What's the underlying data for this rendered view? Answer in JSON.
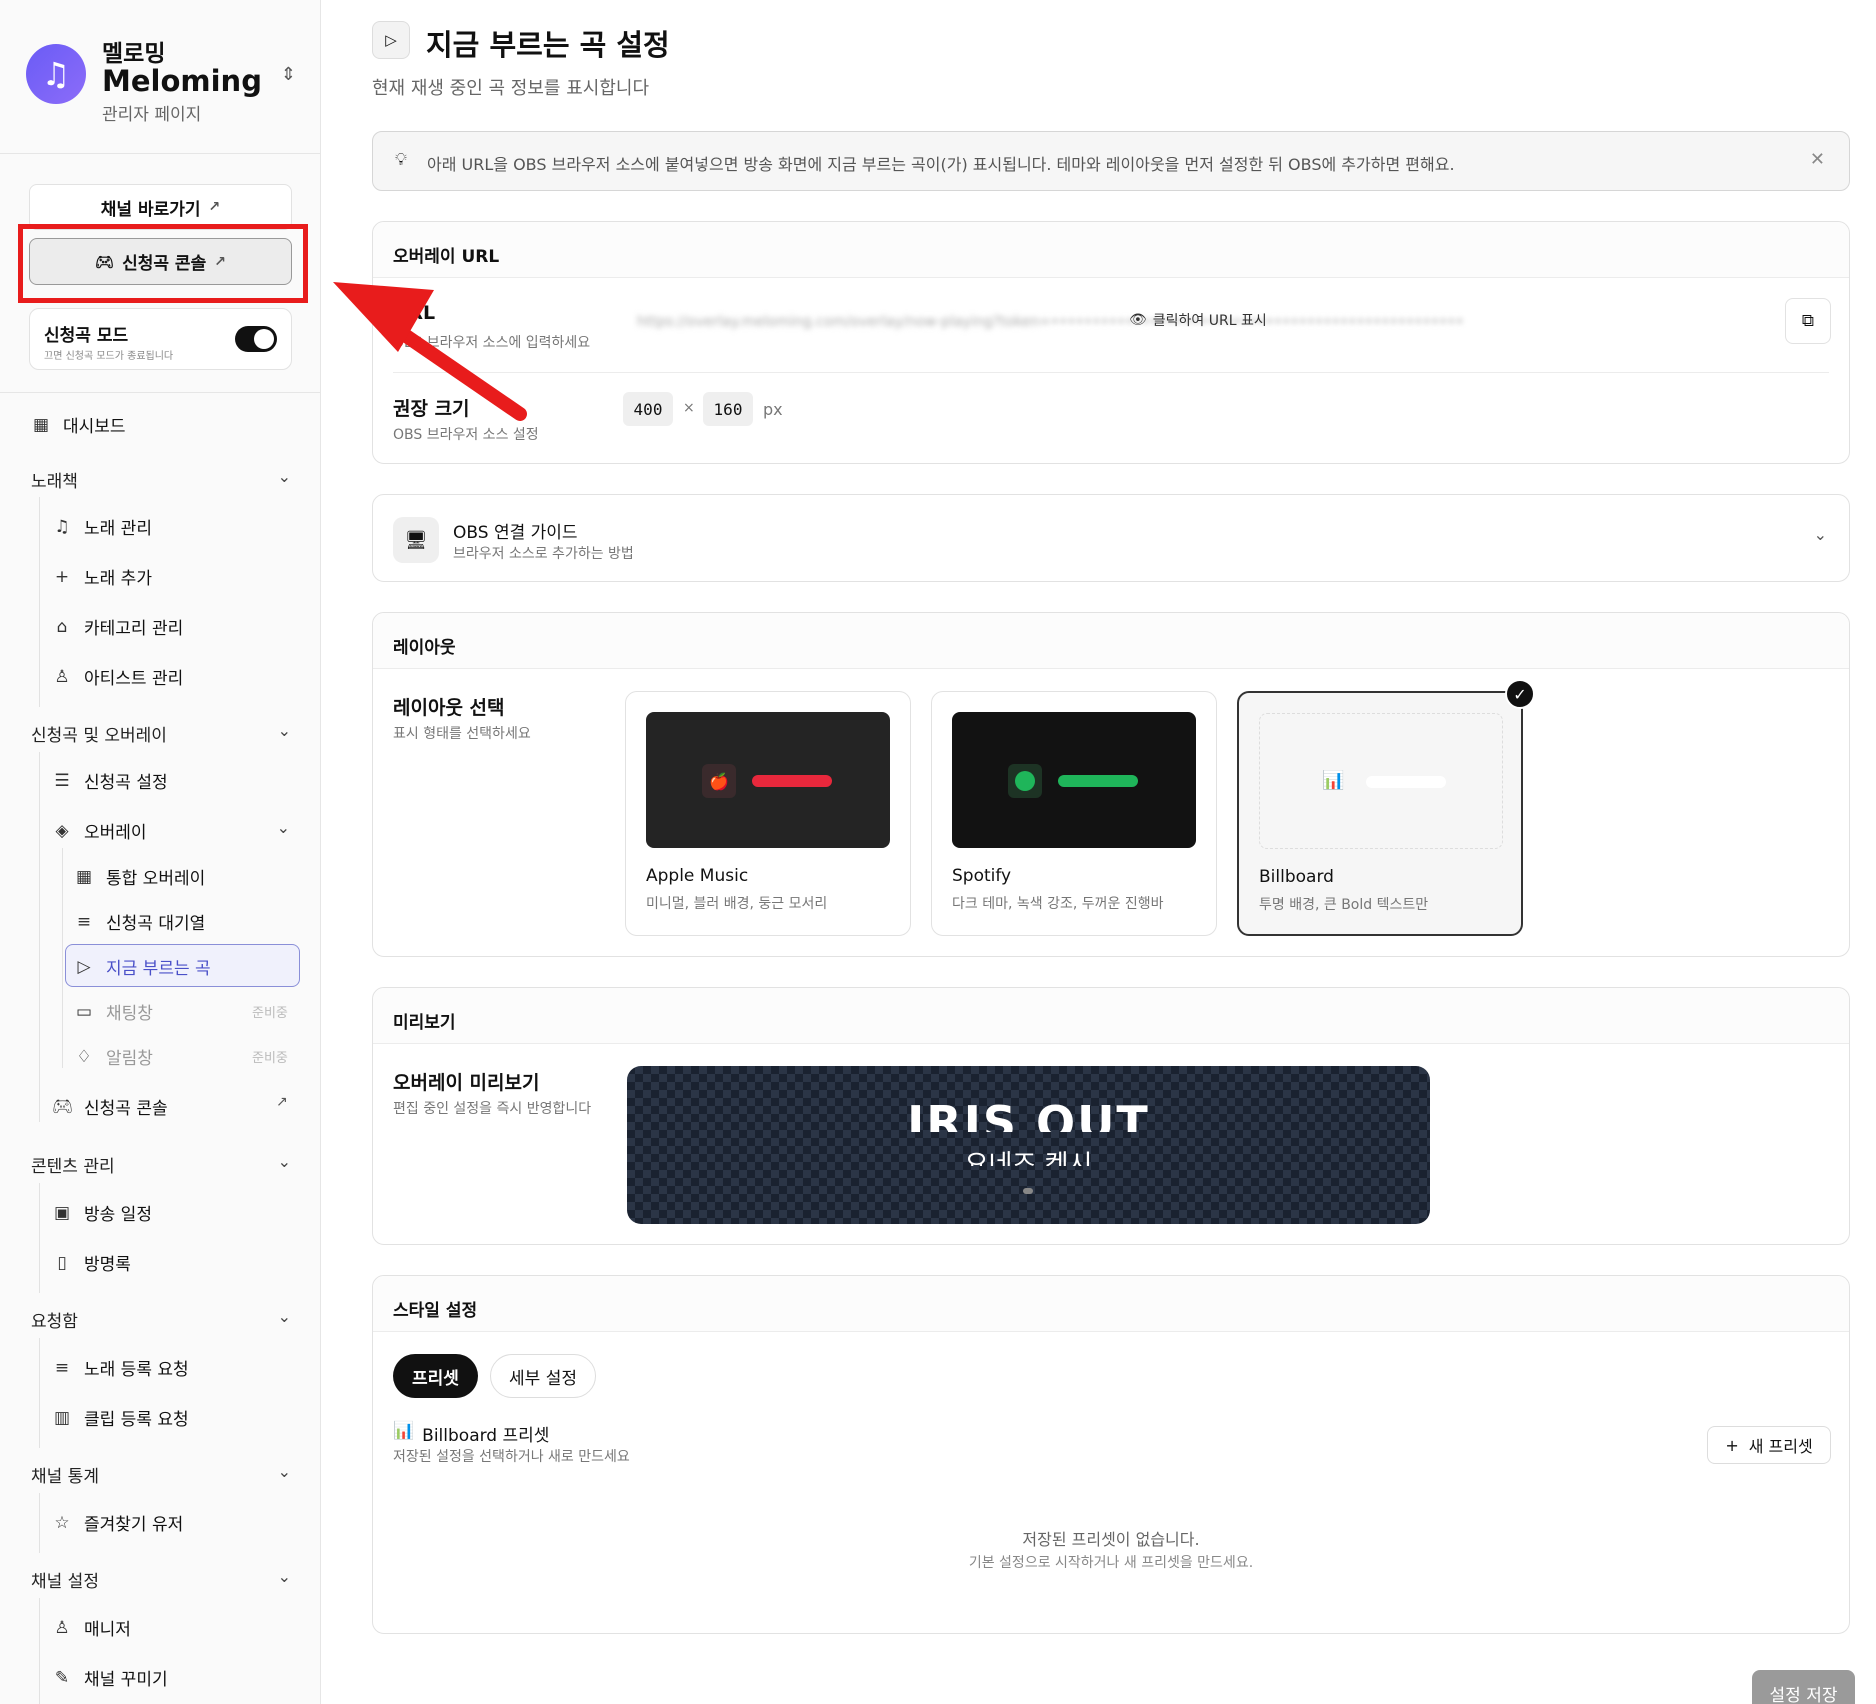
{
  "brand": {
    "name_ko": "멜로밍",
    "name_en": "Meloming",
    "subtitle": "관리자 페이지"
  },
  "sidebar": {
    "channel_button": "채널 바로가기",
    "console_button": "신청곡 콘솔",
    "request_mode": {
      "title": "신청곡 모드",
      "subtitle": "끄면 신청곡 모드가 종료됩니다",
      "enabled": true
    },
    "dashboard": "대시보드",
    "groups": {
      "songbook": {
        "label": "노래책",
        "items": [
          "노래 관리",
          "노래 추가",
          "카테고리 관리",
          "아티스트 관리"
        ]
      },
      "request_overlay": {
        "label": "신청곡 및 오버레이",
        "request_settings": "신청곡 설정",
        "overlay": "오버레이",
        "overlay_items": [
          "통합 오버레이",
          "신청곡 대기열",
          "지금 부르는 곡",
          "채팅창",
          "알림창"
        ],
        "soon": "준비중",
        "console": "신청곡 콘솔"
      },
      "content": {
        "label": "콘텐츠 관리",
        "items": [
          "방송 일정",
          "방명록"
        ]
      },
      "inbox": {
        "label": "요청함",
        "items": [
          "노래 등록 요청",
          "클립 등록 요청"
        ]
      },
      "stats": {
        "label": "채널 통계",
        "items": [
          "즐겨찾기 유저"
        ]
      },
      "channel_settings": {
        "label": "채널 설정",
        "items": [
          "매니저",
          "채널 꾸미기"
        ]
      }
    }
  },
  "page": {
    "title": "지금 부르는 곡 설정",
    "subtitle": "현재 재생 중인 곡 정보를 표시합니다",
    "tip": "아래 URL을 OBS 브라우저 소스에 붙여넣으면 방송 화면에 지금 부르는 곡이(가) 표시됩니다. 테마와 레이아웃을 먼저 설정한 뒤 OBS에 추가하면 편해요."
  },
  "overlay_url": {
    "header": "오버레이 URL",
    "url_label": "URL",
    "url_sub": "OBS 브라우저 소스에 입력하세요",
    "url_masked": "https://overlay.meloming.com/overlay/now-playing?token=••••••••••••••••••••••••••••••••••••••••••••••••••",
    "reveal_label": "클릭하여 URL 표시",
    "size_label": "권장 크기",
    "size_sub": "OBS 브라우저 소스 설정",
    "width": "400",
    "times": "×",
    "height": "160",
    "unit": "px"
  },
  "obs_guide": {
    "title": "OBS 연결 가이드",
    "subtitle": "브라우저 소스로 추가하는 방법"
  },
  "layout": {
    "header": "레이아웃",
    "label": "레이아웃 선택",
    "sub": "표시 형태를 선택하세요",
    "options": [
      {
        "name": "Apple Music",
        "desc": "미니멀, 블러 배경, 둥근 모서리",
        "accent": "#e8283c"
      },
      {
        "name": "Spotify",
        "desc": "다크 테마, 녹색 강조, 두꺼운 진행바",
        "accent": "#1fb55a"
      },
      {
        "name": "Billboard",
        "desc": "투명 배경, 큰 Bold 텍스트만",
        "accent": "#ffffff"
      }
    ],
    "selected": "Billboard"
  },
  "preview": {
    "header": "미리보기",
    "label": "오버레이 미리보기",
    "sub": "편집 중인 설정을 즉시 반영합니다",
    "song": "IRIS OUT",
    "artist": "요네즈 켄시"
  },
  "style": {
    "header": "스타일 설정",
    "tabs": [
      "프리셋",
      "세부 설정"
    ],
    "active_tab": "프리셋",
    "preset_title": "Billboard 프리셋",
    "preset_sub": "저장된 설정을 선택하거나 새로 만드세요",
    "new_preset": "새 프리셋",
    "empty_title": "저장된 프리셋이 없습니다.",
    "empty_sub": "기본 설정으로 시작하거나 새 프리셋을 만드세요."
  },
  "save_button": "설정 저장",
  "colors": {
    "accent_active": "#8a8fd8",
    "highlight": "#e81c1c"
  }
}
